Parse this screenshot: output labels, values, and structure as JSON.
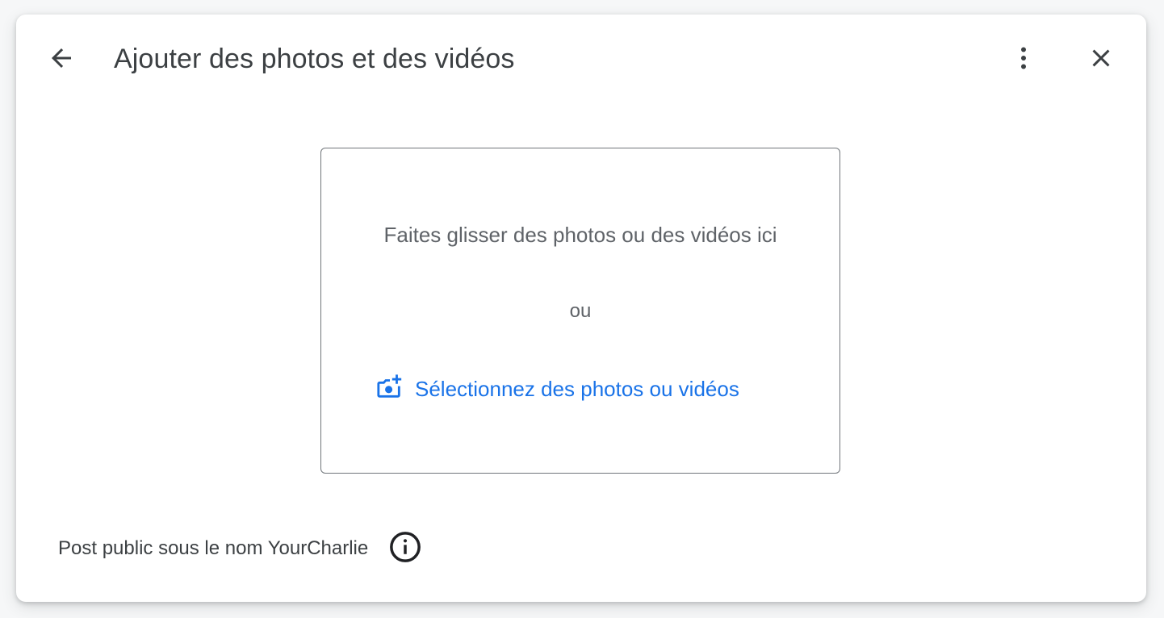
{
  "dialog": {
    "title": "Ajouter des photos et des vidéos",
    "back_icon": "arrow-back-icon",
    "more_icon": "more-vert-icon",
    "close_icon": "close-icon"
  },
  "dropzone": {
    "instruction": "Faites glisser des photos ou des vidéos ici",
    "separator": "ou",
    "select_label": "Sélectionnez des photos ou vidéos",
    "select_icon": "add-photo-icon"
  },
  "footer": {
    "post_visibility": "Post public sous le nom YourCharlie",
    "info_icon": "info-icon"
  },
  "colors": {
    "accent": "#1a73e8",
    "text_primary": "#3c4043",
    "text_secondary": "#5f6368",
    "border": "#70757a"
  }
}
